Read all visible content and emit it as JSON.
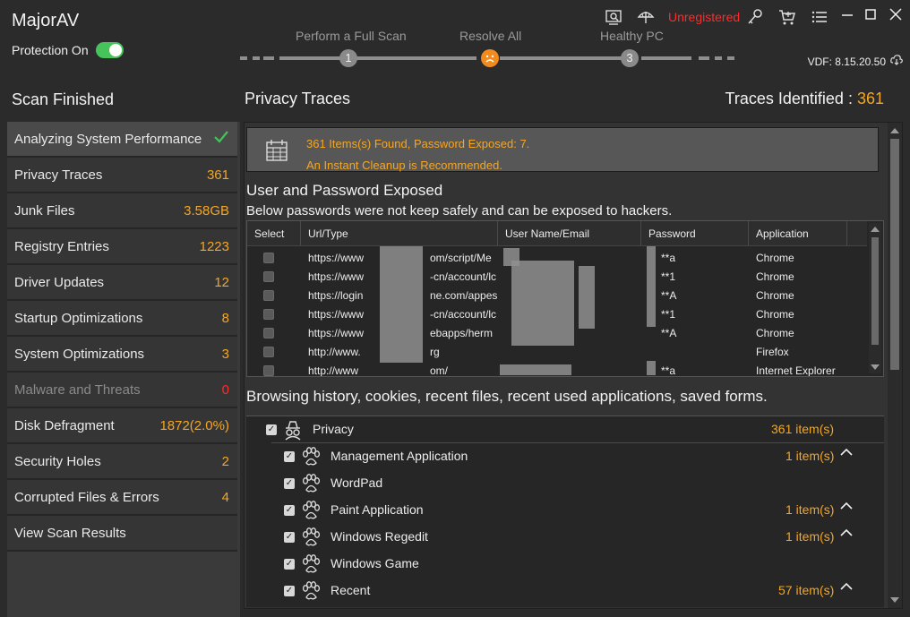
{
  "app": {
    "title": "MajorAV",
    "protection_label": "Protection On",
    "unregistered": "Unregistered",
    "vdf": "VDF: 8.15.20.50"
  },
  "steps": [
    {
      "label": "Perform a Full Scan",
      "num": "1"
    },
    {
      "label": "Resolve All",
      "num": ""
    },
    {
      "label": "Healthy PC",
      "num": "3"
    }
  ],
  "sidebar": {
    "heading": "Scan Finished",
    "items": [
      {
        "label": "Analyzing System Performance",
        "value": ""
      },
      {
        "label": "Privacy Traces",
        "value": "361"
      },
      {
        "label": "Junk Files",
        "value": "3.58GB"
      },
      {
        "label": "Registry Entries",
        "value": "1223"
      },
      {
        "label": "Driver Updates",
        "value": "12"
      },
      {
        "label": "Startup Optimizations",
        "value": "8"
      },
      {
        "label": "System Optimizations",
        "value": "3"
      },
      {
        "label": "Malware and Threats",
        "value": "0"
      },
      {
        "label": "Disk Defragment",
        "value": "1872(2.0%)"
      },
      {
        "label": "Security Holes",
        "value": "2"
      },
      {
        "label": "Corrupted Files & Errors",
        "value": "4"
      },
      {
        "label": "View Scan Results",
        "value": ""
      }
    ]
  },
  "main": {
    "title": "Privacy Traces",
    "traces_label": "Traces Identified : ",
    "traces_count": "361",
    "alert_line1": "361 Items(s) Found, Password Exposed: 7.",
    "alert_line2": "An Instant Cleanup is Recommended.",
    "password_title": "User and Password Exposed",
    "password_sub": "Below passwords were not keep safely and can be exposed to hackers.",
    "columns": [
      "Select",
      "Url/Type",
      "User Name/Email",
      "Password",
      "Application"
    ],
    "rows": [
      {
        "url": "https://www",
        "url2": "om/script/Me",
        "pw": "**a",
        "app": "Chrome"
      },
      {
        "url": "https://www",
        "url2": "-cn/account/lc",
        "pw": "**1",
        "app": "Chrome"
      },
      {
        "url": "https://login",
        "url2": "ne.com/appes",
        "pw": "**A",
        "app": "Chrome"
      },
      {
        "url": "https://www",
        "url2": "-cn/account/lc",
        "pw": "**1",
        "app": "Chrome"
      },
      {
        "url": "https://www",
        "url2": "ebapps/herm",
        "pw": "**A",
        "app": "Chrome"
      },
      {
        "url": "http://www.",
        "url2": "rg",
        "pw": "",
        "app": "Firefox"
      },
      {
        "url": "http://www",
        "url2": "om/",
        "pw": "**a",
        "app": "Internet Explorer"
      }
    ],
    "history_title": "Browsing history, cookies, recent files, recent used applications, saved forms.",
    "tree": [
      {
        "label": "Privacy",
        "count": "361 item(s)",
        "level": 0,
        "caret": false
      },
      {
        "label": "Management Application",
        "count": "1 item(s)",
        "level": 1,
        "caret": true
      },
      {
        "label": "WordPad",
        "count": "",
        "level": 1,
        "caret": false
      },
      {
        "label": "Paint Application",
        "count": "1 item(s)",
        "level": 1,
        "caret": true
      },
      {
        "label": "Windows Regedit",
        "count": "1 item(s)",
        "level": 1,
        "caret": true
      },
      {
        "label": "Windows Game",
        "count": "",
        "level": 1,
        "caret": false
      },
      {
        "label": "Recent",
        "count": "57 item(s)",
        "level": 1,
        "caret": true
      }
    ]
  }
}
